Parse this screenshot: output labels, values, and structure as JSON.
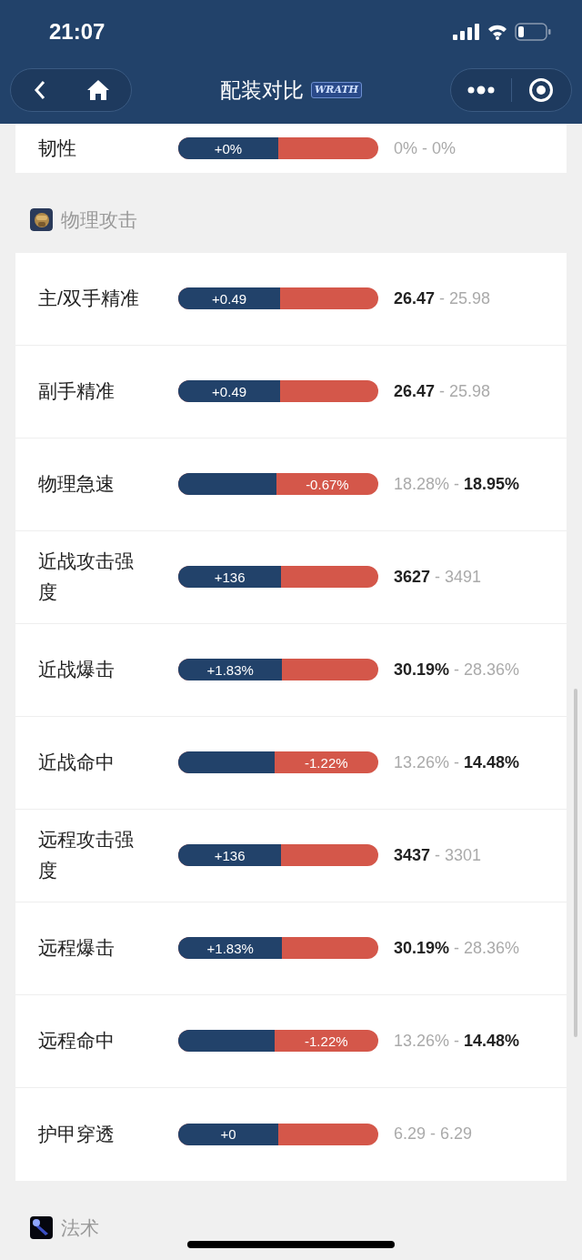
{
  "status_bar": {
    "time": "21:07"
  },
  "nav": {
    "title": "配装对比",
    "logo": "WRATH"
  },
  "sections": [
    {
      "rows": [
        {
          "label": "韧性",
          "diff": "+0%",
          "kind": "even",
          "level": 0.5,
          "values": "0% - 0%"
        }
      ]
    },
    {
      "title": "物理攻击",
      "kind": "physical",
      "rows": [
        {
          "label": "主/双手精准",
          "diff": "+0.49",
          "kind": "gain",
          "level": 0.51,
          "values": "**26.47** - 25.98"
        },
        {
          "label": "副手精准",
          "diff": "+0.49",
          "kind": "gain",
          "level": 0.51,
          "values": "**26.47** - 25.98"
        },
        {
          "label": "物理急速",
          "diff": "-0.67%",
          "kind": "loss",
          "level": 0.49,
          "values": "18.28% - **18.95%**"
        },
        {
          "label": "近战攻击强度",
          "diff": "+136",
          "kind": "gain",
          "level": 0.515,
          "values": "**3627** - 3491"
        },
        {
          "label": "近战爆击",
          "diff": "+1.83%",
          "kind": "gain",
          "level": 0.52,
          "values": "**30.19%** - 28.36%"
        },
        {
          "label": "近战命中",
          "diff": "-1.22%",
          "kind": "loss",
          "level": 0.48,
          "values": "13.26% - **14.48%**"
        },
        {
          "label": "远程攻击强度",
          "diff": "+136",
          "kind": "gain",
          "level": 0.515,
          "values": "**3437** - 3301"
        },
        {
          "label": "远程爆击",
          "diff": "+1.83%",
          "kind": "gain",
          "level": 0.52,
          "values": "**30.19%** - 28.36%"
        },
        {
          "label": "远程命中",
          "diff": "-1.22%",
          "kind": "loss",
          "level": 0.48,
          "values": "13.26% - **14.48%**"
        },
        {
          "label": "护甲穿透",
          "diff": "+0",
          "kind": "even",
          "level": 0.5,
          "values": "6.29 - 6.29"
        }
      ]
    },
    {
      "title": "法术",
      "kind": "spell"
    }
  ]
}
